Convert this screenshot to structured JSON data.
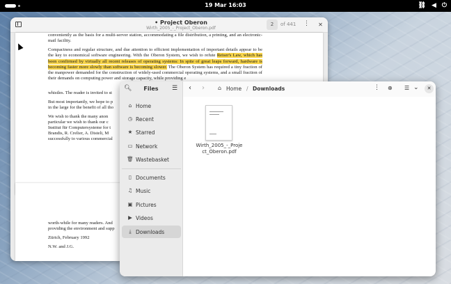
{
  "topbar": {
    "clock": "19 Mar  16:03",
    "network_icon": "network-icon",
    "volume_icon": "volume-icon",
    "power_icon": "power-icon"
  },
  "pdf": {
    "title": "• Project Oberon",
    "subtitle": "Wirth_2005_-_Project_Oberon.pdf",
    "page_current": "2",
    "page_total": "of 441",
    "p1_line1": "conveniently as the basis for a multi-server station, accommodating a file distribution, a printing, and an electronic-mail facility.",
    "p2_start": "Compactness and regular structure, and due attention to efficient implementation of important details appear to be the key to economical software engineering. With the Oberon System, we wish to refute ",
    "p2_highlight": "Reiser's Law, which has been confirmed by virtually all recent releases of operating systems: In spite of great leaps forward, hardware is becoming faster more slowly than software is becoming slower.",
    "p2_end": " The Oberon System has required a tiny fraction of the manpower demanded for the construction of widely-used commercial operating systems, and a small fraction of their demands on computing power and storage capacity, while providing e",
    "p2_tail": "whistles. The reader is invited to st",
    "p3": "But most importantly, we hope to p",
    "p3b": "in the large for the benefit of all tho",
    "p4a": "We wish to thank the many anon",
    "p4b": "particular we wish to thank our c",
    "p4c": "Institut für Computersysteme for t",
    "p4d": "Brandis, R. Crelier, A. Disteli, M",
    "p4e": "successfully to various commercial",
    "p5a": "worth-while for many readers. And",
    "p5b": "providing the environment and supp",
    "p6": "Zürich, February 1992",
    "p7": "N.W. and J.G."
  },
  "files": {
    "title": "Files",
    "sidebar": [
      {
        "label": "Home",
        "icon": "home-icon"
      },
      {
        "label": "Recent",
        "icon": "clock-icon"
      },
      {
        "label": "Starred",
        "icon": "star-icon"
      },
      {
        "label": "Network",
        "icon": "network-icon"
      },
      {
        "label": "Wastebasket",
        "icon": "trash-icon"
      },
      {
        "label": "Documents",
        "icon": "document-icon"
      },
      {
        "label": "Music",
        "icon": "music-icon"
      },
      {
        "label": "Pictures",
        "icon": "picture-icon"
      },
      {
        "label": "Videos",
        "icon": "video-icon"
      },
      {
        "label": "Downloads",
        "icon": "download-icon"
      }
    ],
    "breadcrumb_home": "Home",
    "breadcrumb_sep": "/",
    "breadcrumb_current": "Downloads",
    "file_name": "Wirth_2005_-_Project_Oberon.pdf"
  }
}
